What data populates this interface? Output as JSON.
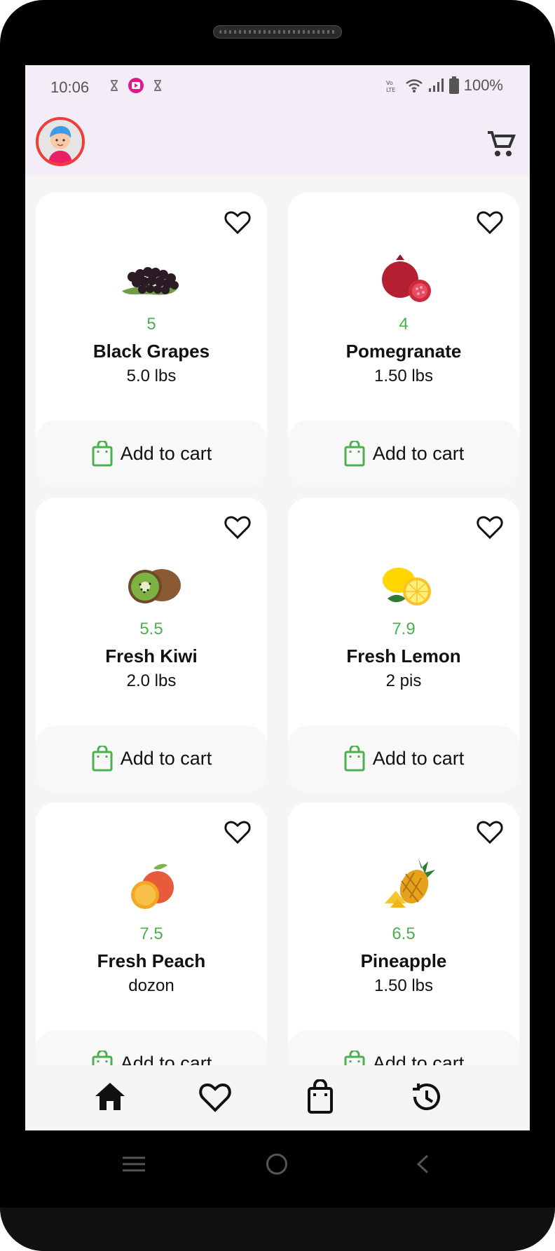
{
  "status": {
    "time": "10:06",
    "battery": "100%"
  },
  "products": [
    {
      "name": "Black Grapes",
      "price": "5",
      "qty": "5.0 lbs",
      "image": "grapes-image",
      "cta": "Add to cart"
    },
    {
      "name": "Pomegranate",
      "price": "4",
      "qty": "1.50 lbs",
      "image": "pomegranate-image",
      "cta": "Add to cart"
    },
    {
      "name": "Fresh Kiwi",
      "price": "5.5",
      "qty": "2.0 lbs",
      "image": "kiwi-image",
      "cta": "Add to cart"
    },
    {
      "name": "Fresh Lemon",
      "price": "7.9",
      "qty": "2 pis",
      "image": "lemon-image",
      "cta": "Add to cart"
    },
    {
      "name": "Fresh Peach",
      "price": "7.5",
      "qty": "dozon",
      "image": "peach-image",
      "cta": "Add to cart"
    },
    {
      "name": "Pineapple",
      "price": "6.5",
      "qty": "1.50 lbs",
      "image": "pineapple-image",
      "cta": "Add to cart"
    }
  ],
  "nav": {
    "items": [
      "home-icon",
      "heart-icon",
      "bag-icon",
      "history-icon"
    ]
  },
  "colors": {
    "accent": "#4caf50",
    "appbar": "#f2edf6",
    "avatar_ring": "#f03d35"
  }
}
